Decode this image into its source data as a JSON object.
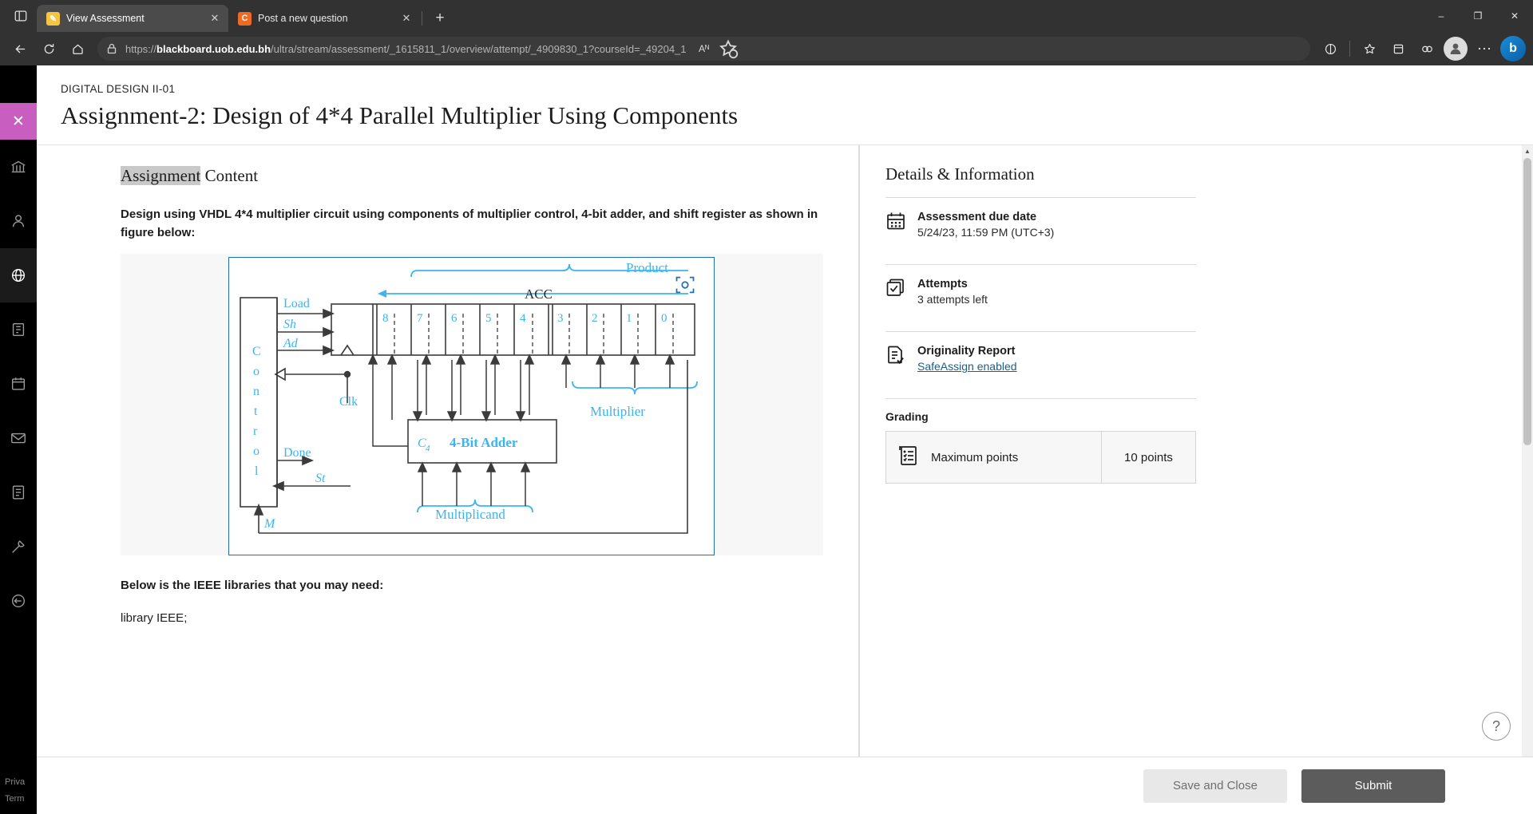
{
  "browser": {
    "tabs": [
      {
        "title": "View Assessment",
        "favicon": "pencil-icon",
        "active": true
      },
      {
        "title": "Post a new question",
        "favicon": "chegg-c-icon",
        "active": false
      }
    ],
    "newtab_label": "+",
    "window_controls": {
      "minimize": "–",
      "maximize": "❐",
      "close": "✕"
    },
    "toolbar": {
      "back": "←",
      "refresh": "↻",
      "home": "⌂",
      "url_prefix": "https://",
      "url_domain": "blackboard.uob.edu.bh",
      "url_path": "/ultra/stream/assessment/_1615811_1/overview/attempt/_4909830_1?courseId=_49204_1",
      "url_full": "https://blackboard.uob.edu.bh/ultra/stream/assessment/_1615811_1/overview/attempt/_4909830_1?courseId=_49204_1",
      "read_aloud": "Aᴺ",
      "collections_alt": "favorites-add-icon",
      "split_screen": "split-screen-icon",
      "favorites": "favorites-icon",
      "collections": "collections-icon",
      "browser_essentials": "browser-essentials-icon",
      "profile": "profile-icon",
      "settings_more": "⋯",
      "copilot": "b"
    }
  },
  "rail": {
    "close_label": "✕",
    "items": [
      {
        "name": "institution-icon"
      },
      {
        "name": "profile-icon"
      },
      {
        "name": "globe-icon"
      },
      {
        "name": "courses-icon"
      },
      {
        "name": "calendar-icon"
      },
      {
        "name": "messages-icon"
      },
      {
        "name": "grades-icon"
      },
      {
        "name": "tools-icon"
      },
      {
        "name": "signout-icon"
      }
    ],
    "footer_lines": [
      "Priva",
      "Term"
    ]
  },
  "header": {
    "course": "DIGITAL DESIGN II-01",
    "title": "Assignment-2: Design of 4*4 Parallel Multiplier Using Components"
  },
  "content": {
    "heading_highlighted": "Assignment",
    "heading_rest": " Content",
    "paragraph": "Design using VHDL 4*4 multiplier circuit using components of multiplier control, 4-bit adder, and shift register as shown in figure below:",
    "after_figure_bold": "Below is the IEEE libraries that you may need:",
    "after_figure_code": "library IEEE;",
    "figure": {
      "camera_icon": "camera-icon",
      "more_label": "•••",
      "labels": {
        "product": "Product",
        "acc": "ACC",
        "load": "Load",
        "sh": "Sh",
        "ad": "Ad",
        "clk": "Clk",
        "control": "Control",
        "done": "Done",
        "st": "St",
        "m": "M",
        "c4": "C",
        "c4_sub": "4",
        "adder": "4-Bit Adder",
        "multiplier": "Multiplier",
        "multiplicand": "Multiplicand"
      },
      "bit_numbers": [
        "8",
        "7",
        "6",
        "5",
        "4",
        "3",
        "2",
        "1",
        "0"
      ]
    }
  },
  "details": {
    "title": "Details & Information",
    "items": [
      {
        "icon": "calendar-icon",
        "label": "Assessment due date",
        "value": "5/24/23, 11:59 PM (UTC+3)",
        "link": null
      },
      {
        "icon": "attempts-check-icon",
        "label": "Attempts",
        "value": "3 attempts left",
        "link": null
      },
      {
        "icon": "originality-report-icon",
        "label": "Originality Report",
        "value": null,
        "link": "SafeAssign enabled"
      }
    ],
    "grading": {
      "section_label": "Grading",
      "icon": "rubric-icon",
      "row_label": "Maximum points",
      "row_value": "10 points"
    }
  },
  "footer": {
    "save_and_close": "Save and Close",
    "submit": "Submit",
    "help_icon": "question-mark-icon"
  }
}
